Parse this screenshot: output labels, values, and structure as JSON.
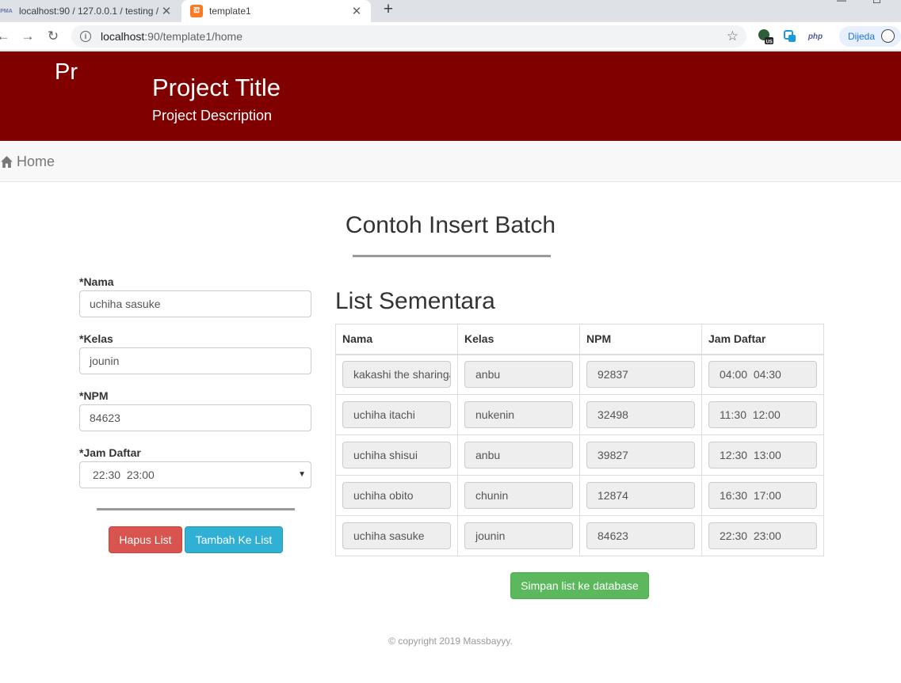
{
  "browser": {
    "tabs": [
      {
        "title": "localhost:90 / 127.0.0.1 / testing /",
        "favicon": "PMA",
        "active": false
      },
      {
        "title": "template1",
        "favicon": "xampp",
        "active": true
      }
    ],
    "url_host": "localhost",
    "url_path": ":90/template1/home",
    "extensions": {
      "php_label": "php"
    },
    "profile_label": "Dijeda"
  },
  "header": {
    "logo_text": "Pr",
    "title": "Project Title",
    "description": "Project Description",
    "background_color": "#800000"
  },
  "nav": {
    "home_label": "Home"
  },
  "main": {
    "heading": "Contoh Insert Batch",
    "form": {
      "nama_label": "*Nama",
      "nama_value": "uchiha sasuke",
      "kelas_label": "*Kelas",
      "kelas_value": "jounin",
      "npm_label": "*NPM",
      "npm_value": "84623",
      "jam_label": "*Jam Daftar",
      "jam_value": "22:30  23:00",
      "hapus_label": "Hapus List",
      "tambah_label": "Tambah Ke List"
    },
    "list": {
      "title": "List Sementara",
      "columns": [
        "Nama",
        "Kelas",
        "NPM",
        "Jam Daftar"
      ],
      "rows": [
        [
          "kakashi the sharingan",
          "anbu",
          "92837",
          "04:00  04:30"
        ],
        [
          "uchiha itachi",
          "nukenin",
          "32498",
          "11:30  12:00"
        ],
        [
          "uchiha shisui",
          "anbu",
          "39827",
          "12:30  13:00"
        ],
        [
          "uchiha obito",
          "chunin",
          "12874",
          "16:30  17:00"
        ],
        [
          "uchiha sasuke",
          "jounin",
          "84623",
          "22:30  23:00"
        ]
      ]
    },
    "save_label": "Simpan list ke database"
  },
  "footer": {
    "copyright": "© copyright 2019 Massbayyy."
  },
  "colors": {
    "danger": "#d9534f",
    "info": "#31b0d5",
    "success": "#5cb85c"
  }
}
